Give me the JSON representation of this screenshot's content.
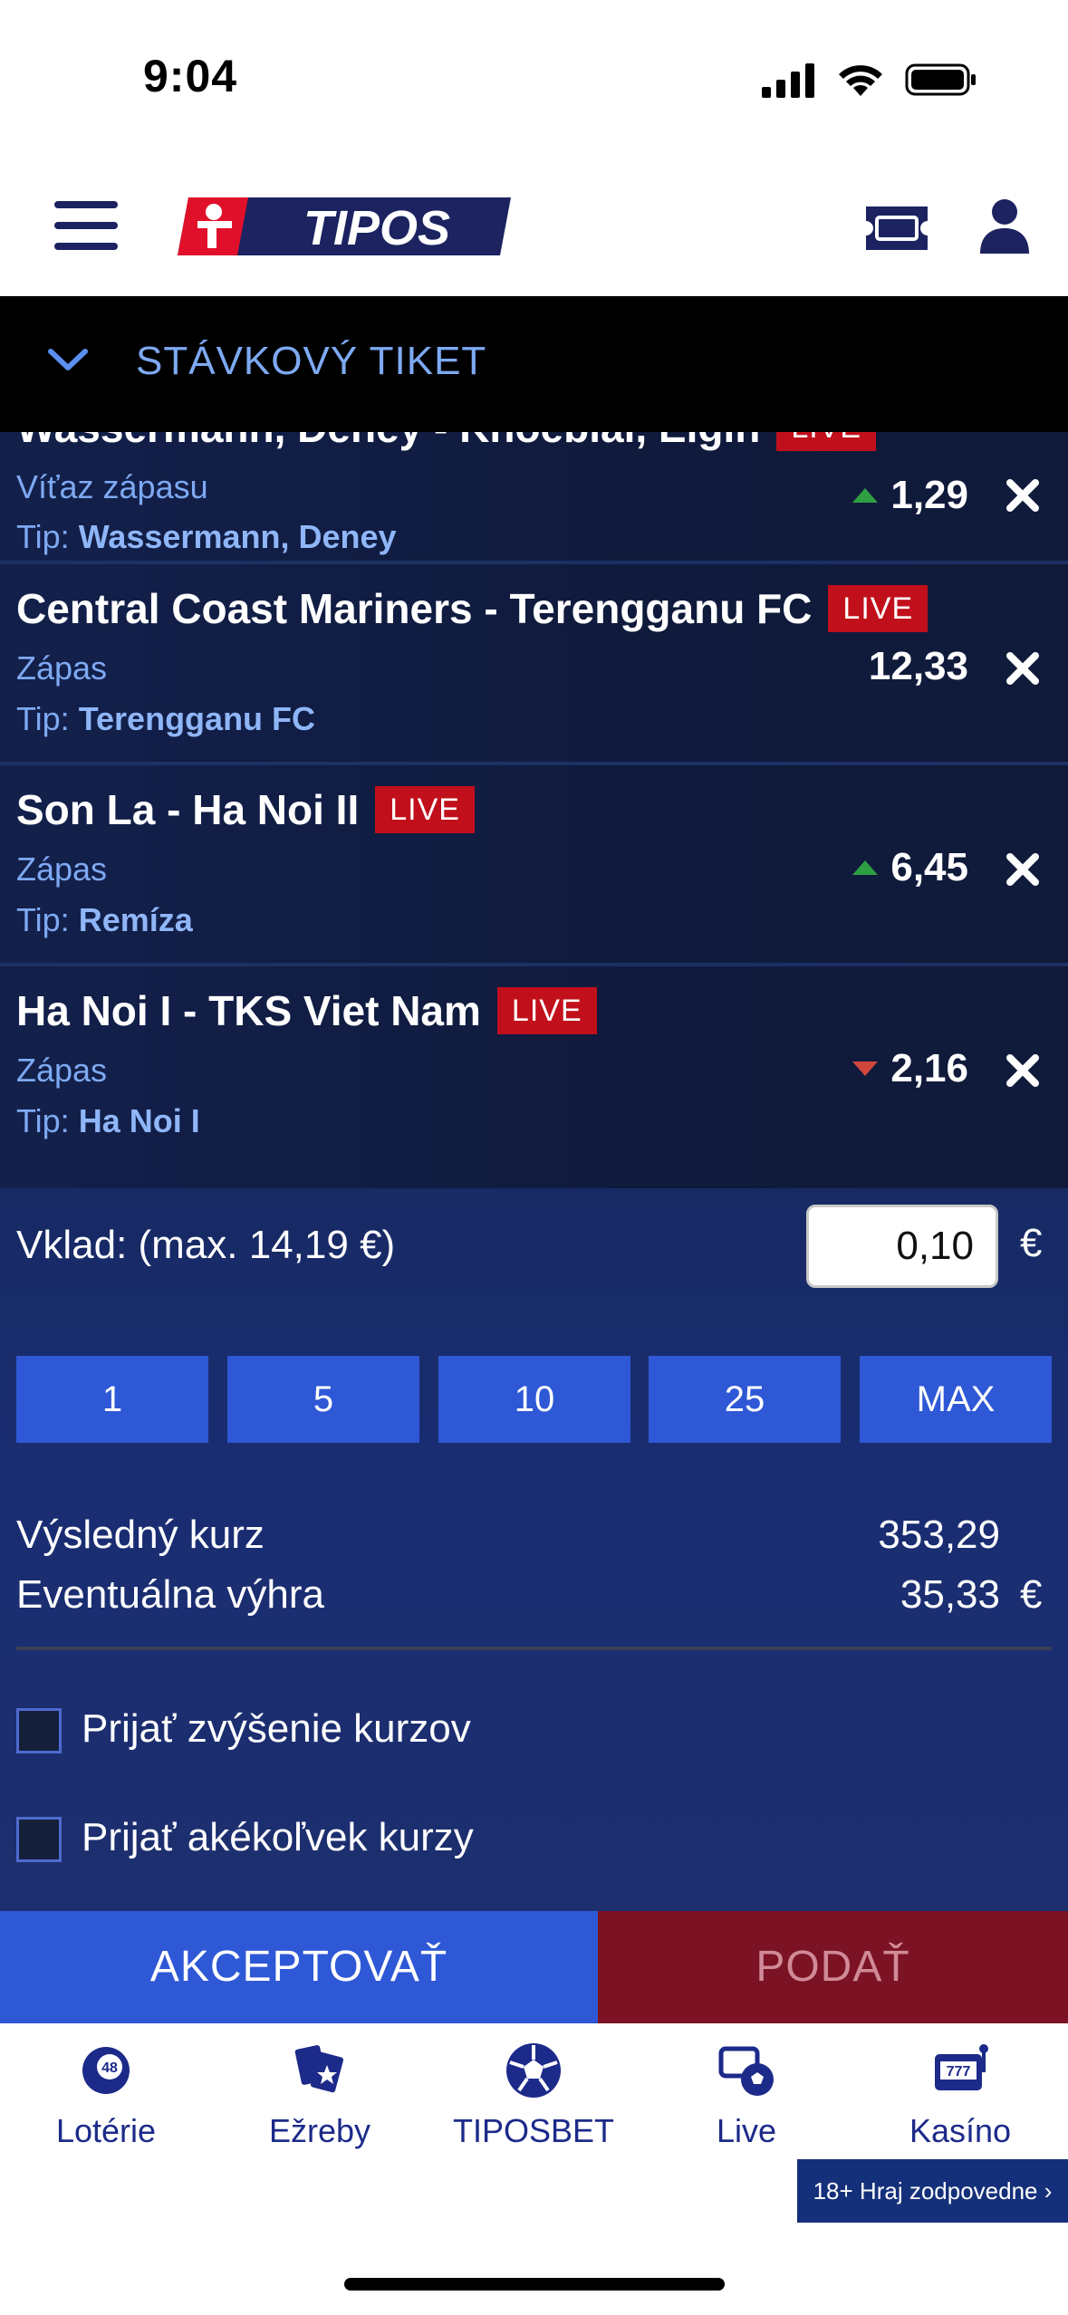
{
  "status_bar": {
    "time": "9:04"
  },
  "header": {
    "logo_text": "TIPOS"
  },
  "slip": {
    "title": "STÁVKOVÝ TIKET"
  },
  "bets": [
    {
      "title": "Wassermann, Deney - Knoebiai, Elgin",
      "live": "LIVE",
      "market": "Víťaz zápasu",
      "tip_label": "Tip:",
      "tip": "Wassermann, Deney",
      "odds": "1,29",
      "trend": "up"
    },
    {
      "title": "Central Coast Mariners - Terengganu FC",
      "live": "LIVE",
      "market": "Zápas",
      "tip_label": "Tip:",
      "tip": "Terengganu FC",
      "odds": "12,33",
      "trend": "none"
    },
    {
      "title": "Son La - Ha Noi II",
      "live": "LIVE",
      "market": "Zápas",
      "tip_label": "Tip:",
      "tip": "Remíza",
      "odds": "6,45",
      "trend": "up"
    },
    {
      "title": "Ha Noi I - TKS Viet Nam",
      "live": "LIVE",
      "market": "Zápas",
      "tip_label": "Tip:",
      "tip": "Ha Noi I",
      "odds": "2,16",
      "trend": "down"
    }
  ],
  "stake": {
    "label": "Vklad: (max. 14,19 €)",
    "value": "0,10",
    "currency": "€",
    "quick_buttons": [
      "1",
      "5",
      "10",
      "25",
      "MAX"
    ]
  },
  "summary": {
    "total_odds_label": "Výsledný kurz",
    "total_odds": "353,29",
    "win_label": "Eventuálna výhra",
    "win": "35,33",
    "currency": "€"
  },
  "options": {
    "accept_higher": "Prijať zvýšenie kurzov",
    "accept_any": "Prijať akékoľvek kurzy"
  },
  "actions": {
    "accept": "AKCEPTOVAŤ",
    "submit": "PODAŤ"
  },
  "nav": {
    "loterie": "Lotérie",
    "zreby": "Ežreby",
    "tiposbet": "TIPOSBET",
    "live": "Live",
    "kasino": "Kasíno",
    "lottery_ball_number": "48",
    "slot_digits": "777"
  },
  "responsible": "18+ Hraj zodpovedne ›",
  "colors": {
    "brand_blue": "#2e58d6",
    "brand_red": "#e1102a",
    "live_red": "#c1101b",
    "nav_blue": "#1c2a8a"
  }
}
